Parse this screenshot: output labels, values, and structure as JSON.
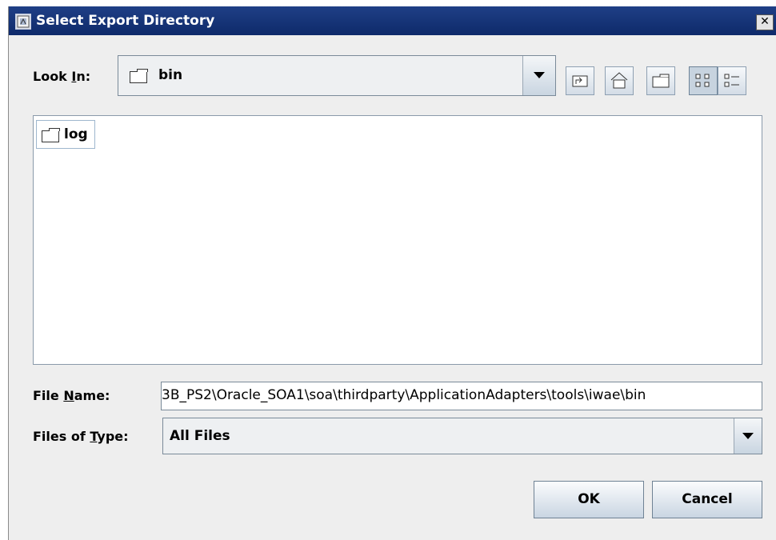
{
  "dialog": {
    "title": "Select Export Directory",
    "close_glyph": "✕"
  },
  "look_in": {
    "label_pre": "Look ",
    "label_mnemonic": "I",
    "label_post": "n:",
    "value": "bin"
  },
  "toolbar": {
    "icons": [
      "up-one-level-icon",
      "home-icon",
      "new-folder-icon",
      "list-view-icon",
      "details-view-icon"
    ]
  },
  "file_list": {
    "items": [
      {
        "name": "log"
      }
    ]
  },
  "file_name": {
    "label_pre": "File ",
    "label_mnemonic": "N",
    "label_post": "ame:",
    "value": "3B_PS2\\Oracle_SOA1\\soa\\thirdparty\\ApplicationAdapters\\tools\\iwae\\bin"
  },
  "file_type": {
    "label_pre": "Files of ",
    "label_mnemonic": "T",
    "label_post": "ype:",
    "value": "All Files"
  },
  "buttons": {
    "ok": "OK",
    "cancel": "Cancel"
  },
  "colors": {
    "titlebar": "#0e2a6a",
    "dialog_bg": "#eeeeee",
    "button_gradient_end": "#c9d5e2"
  }
}
